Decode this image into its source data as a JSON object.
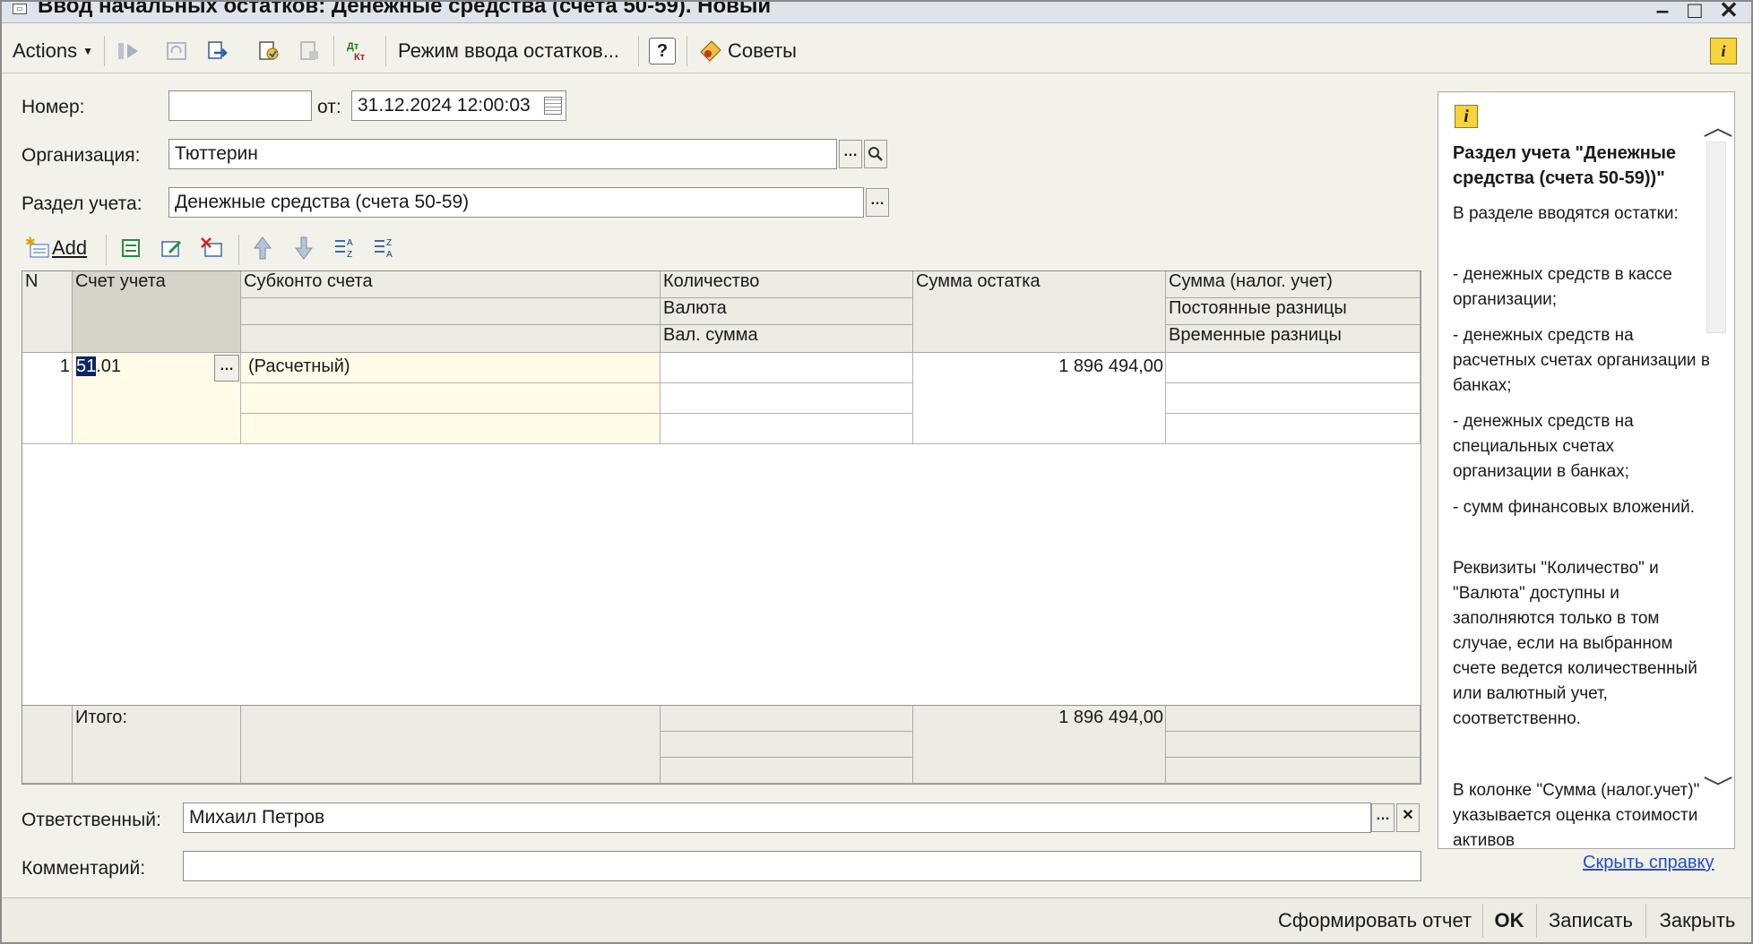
{
  "window": {
    "title": "Ввод начальных остатков: Денежные средства (счета 50-59). Новый"
  },
  "toolbar": {
    "actions_label": "Actions",
    "balance_mode_label": "Режим ввода остатков...",
    "help_label": "?",
    "tips_label": "Советы"
  },
  "form": {
    "number_label": "Номер:",
    "number_value": "",
    "date_label": "от:",
    "date_value": "31.12.2024 12:00:03",
    "org_label": "Организация:",
    "org_value": "Тюттерин",
    "section_label": "Раздел учета:",
    "section_value": "Денежные средства (счета 50-59)",
    "responsible_label": "Ответственный:",
    "responsible_value": "Михаил Петров",
    "comment_label": "Комментарий:",
    "comment_value": ""
  },
  "grid": {
    "add_label": "Add",
    "headers": {
      "n": "N",
      "account": "Счет учета",
      "subconto": "Субконто счета",
      "qty": "Количество",
      "currency": "Валюта",
      "cur_sum": "Вал. сумма",
      "balance": "Сумма остатка",
      "tax_sum": "Сумма (налог. учет)",
      "perm_diff": "Постоянные разницы",
      "temp_diff": "Временные разницы"
    },
    "rows": [
      {
        "n": "1",
        "account_sel": "51",
        "account_rest": ".01",
        "subconto": "(Расчетный)",
        "balance": "1 896 494,00"
      }
    ],
    "total_label": "Итого:",
    "total_balance": "1 896 494,00"
  },
  "help": {
    "title": "Раздел учета \"Денежные средства (счета 50-59))\"",
    "p1": "В разделе вводятся остатки:",
    "p2": "- денежных средств в кассе организации;",
    "p3": "- денежных средств на расчетных счетах организации в банках;",
    "p4": "- денежных средств на специальных счетах организации в банках;",
    "p5": "- сумм финансовых вложений.",
    "p6": "Реквизиты \"Количество\" и \"Валюта\" доступны и заполняются только в том случае, если на выбранном счете ведется количественный или валютный учет, соответственно.",
    "p7": "В колонке \"Сумма (налог.учет)\" указывается оценка стоимости активов",
    "hide_link": "Скрыть справку"
  },
  "bottom": {
    "report_label": "Сформировать отчет",
    "ok_label": "OK",
    "save_label": "Записать",
    "close_label": "Закрыть"
  }
}
